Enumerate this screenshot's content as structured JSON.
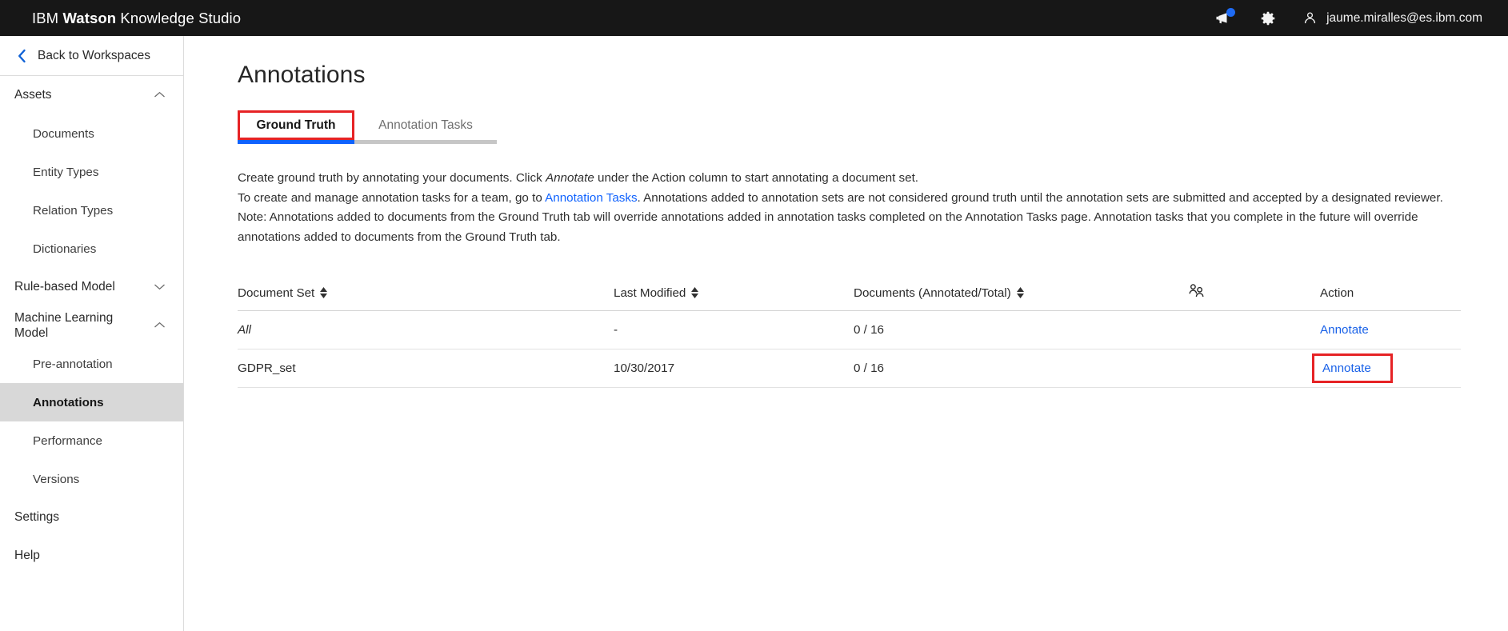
{
  "topbar": {
    "brand_prefix": "IBM ",
    "brand_bold": "Watson",
    "brand_suffix": " Knowledge Studio",
    "announcements_icon": "megaphone-icon",
    "settings_icon": "gear-icon",
    "user_icon": "user-avatar-icon",
    "user_email": "jaume.miralles@es.ibm.com",
    "notification_color": "#1f6bf3",
    "background": "#171717"
  },
  "sidebar": {
    "back_label": "Back to Workspaces",
    "groups": [
      {
        "label": "Assets",
        "state": "expanded",
        "chevron": "chevron-up-icon"
      },
      {
        "label": "Rule-based Model",
        "state": "collapsed",
        "chevron": "chevron-down-icon"
      },
      {
        "label": "Machine Learning Model",
        "state": "expanded",
        "chevron": "chevron-up-icon"
      }
    ],
    "assets_items": [
      {
        "label": "Documents"
      },
      {
        "label": "Entity Types"
      },
      {
        "label": "Relation Types"
      },
      {
        "label": "Dictionaries"
      }
    ],
    "ml_items": [
      {
        "label": "Pre-annotation",
        "active": false
      },
      {
        "label": "Annotations",
        "active": true
      },
      {
        "label": "Performance",
        "active": false
      },
      {
        "label": "Versions",
        "active": false
      }
    ],
    "footer_items": [
      {
        "label": "Settings"
      },
      {
        "label": "Help"
      }
    ]
  },
  "main": {
    "page_title": "Annotations",
    "tabs": [
      {
        "label": "Ground Truth",
        "active": true,
        "highlighted": true
      },
      {
        "label": "Annotation Tasks",
        "active": false,
        "highlighted": false
      }
    ],
    "description": {
      "line1_a": "Create ground truth by annotating your documents. Click ",
      "line1_em": "Annotate",
      "line1_b": " under the Action column to start annotating a document set.",
      "line2_a": "To create and manage annotation tasks for a team, go to ",
      "line2_link": "Annotation Tasks",
      "line2_b": ". Annotations added to annotation sets are not considered ground truth until the annotation sets are submitted and accepted by a designated reviewer.",
      "line3": "Note: Annotations added to documents from the Ground Truth tab will override annotations added in annotation tasks completed on the Annotation Tasks page. Annotation tasks that you complete in the future will override annotations added to documents from the Ground Truth tab."
    },
    "table": {
      "headers": [
        {
          "label": "Document Set",
          "sortable": true
        },
        {
          "label": "Last Modified",
          "sortable": true
        },
        {
          "label": "Documents (Annotated/Total)",
          "sortable": true
        },
        {
          "label": "",
          "icon": "two-people-icon",
          "sortable": false
        },
        {
          "label": "Action",
          "sortable": false
        }
      ],
      "rows": [
        {
          "document_set": "All",
          "italic": true,
          "last_modified": "-",
          "documents": "0 / 16",
          "people": "",
          "action_label": "Annotate",
          "action_highlighted": false
        },
        {
          "document_set": "GDPR_set",
          "italic": false,
          "last_modified": "10/30/2017",
          "documents": "0 / 16",
          "people": "",
          "action_label": "Annotate",
          "action_highlighted": true
        }
      ]
    }
  },
  "colors": {
    "accent_blue": "#0f62fe",
    "link_blue": "#1a62e8",
    "highlight_red": "#e62325",
    "active_nav_bg": "#d8d8d8"
  }
}
